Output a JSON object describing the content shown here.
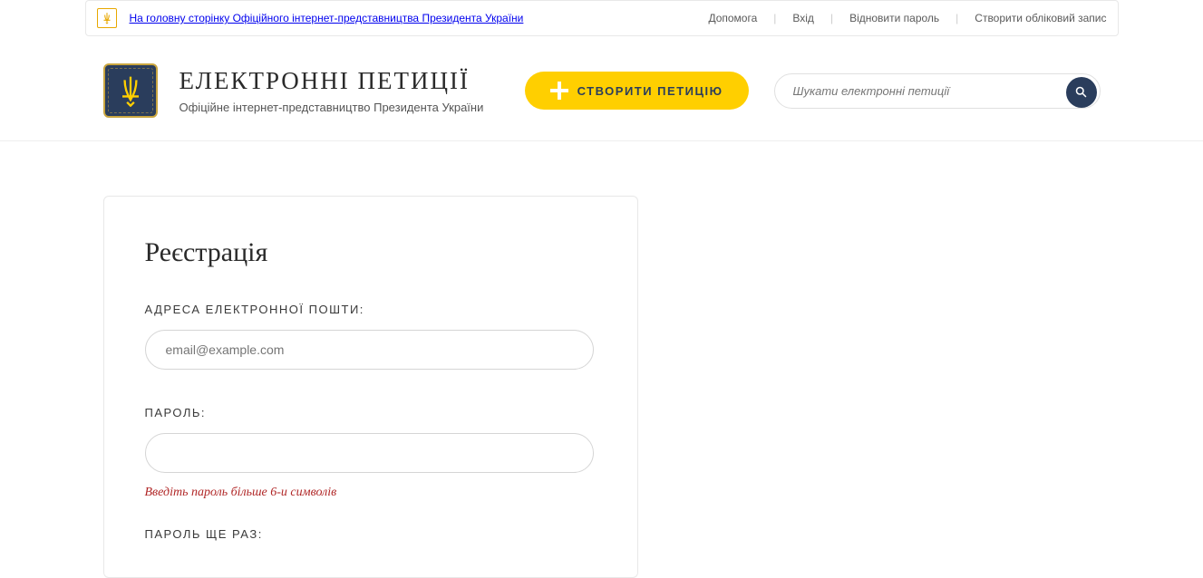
{
  "topbar": {
    "home_link": "На головну сторінку Офіційного інтернет-представництва Президента України",
    "help": "Допомога",
    "login": "Вхід",
    "restore": "Відновити пароль",
    "create_account": "Створити обліковий запис"
  },
  "header": {
    "title": "ЕЛЕКТРОННІ ПЕТИЦІЇ",
    "subtitle": "Офіційне інтернет-представництво Президента України",
    "create_button": "СТВОРИТИ ПЕТИЦІЮ",
    "search_placeholder": "Шукати електронні петиції"
  },
  "form": {
    "title": "Реєстрація",
    "email_label": "АДРЕСА ЕЛЕКТРОННОЇ ПОШТИ:",
    "email_placeholder": "email@example.com",
    "password_label": "ПАРОЛЬ:",
    "password_error": "Введіть пароль більше 6-и символів",
    "password_repeat_label": "ПАРОЛЬ ЩЕ РАЗ:"
  }
}
